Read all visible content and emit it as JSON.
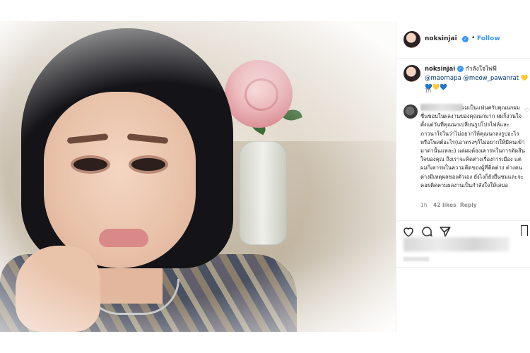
{
  "post": {
    "username": "noksinjai",
    "follow_label": "Follow",
    "dot": "•",
    "caption_username": "noksinjai",
    "caption_text": "กำลังใจไพ่ฟี",
    "caption_mentions": "@maornapa @meow_pawanrat",
    "caption_hearts": "💛💙💛💙",
    "caption_time": "1h"
  },
  "comment": {
    "text": "ผมเป็นแฟนครับคุณนกผมชื่นชอบในผลงานของคุณนกมาก ผมก็งวนใจตั้งแต่วันที่คุณนกเปลี่ยนรูปโปรไฟล์และ ภาวนาใจในว่าไม่อยากให้คุณนกลงรูปอะไรหรือโพสต์อะไร(เอาตรงๆก็ไม่อยากให้มีคนเข้ามาด่านั้นแหละ) แต่ผมต้องเคารพในการตัดสินใจของคุณ ถึงเราจะคิดต่างเรื่องการเมือง แต่ผมก็เคารพในความคิดของผู้ที่คิดต่าง ต่างคนต่างมีเหตุผลของตัวเอง ยังไงก็ยังยื่นชมและจะคอยติดตามผลงานเป็นกำลังใจให้เสมอ",
    "time": "1h",
    "likes": "42 likes",
    "reply": "Reply"
  },
  "icons": [
    "heart-icon",
    "comment-icon",
    "share-icon",
    "bookmark-icon",
    "verified-badge-icon"
  ],
  "colors": {
    "link": "#3897f0",
    "mention": "#003569",
    "text": "#262626",
    "meta": "#8e8e8e"
  }
}
